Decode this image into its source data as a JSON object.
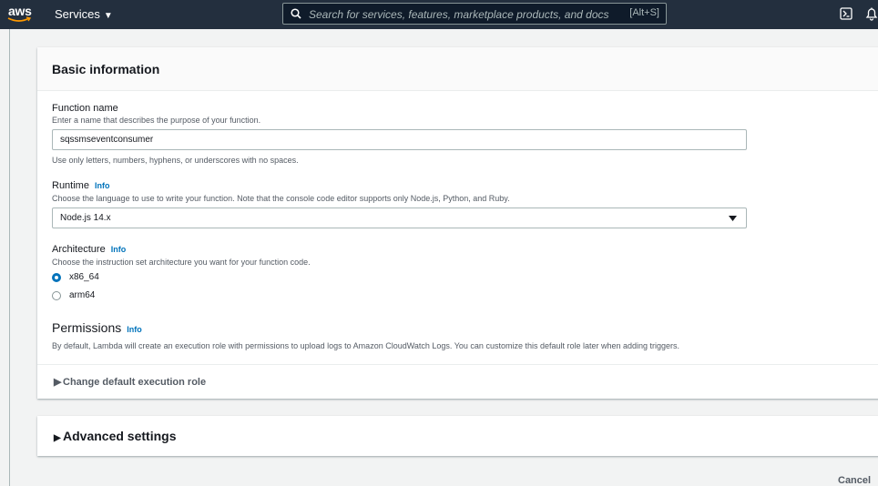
{
  "nav": {
    "logo_text": "aws",
    "services_label": "Services",
    "search_placeholder": "Search for services, features, marketplace products, and docs",
    "search_shortcut": "[Alt+S]"
  },
  "basic_info": {
    "title": "Basic information",
    "function_name": {
      "label": "Function name",
      "description": "Enter a name that describes the purpose of your function.",
      "value": "sqssmseventconsumer",
      "hint": "Use only letters, numbers, hyphens, or underscores with no spaces."
    },
    "runtime": {
      "label": "Runtime",
      "info": "Info",
      "description": "Choose the language to use to write your function. Note that the console code editor supports only Node.js, Python, and Ruby.",
      "selected": "Node.js 14.x"
    },
    "architecture": {
      "label": "Architecture",
      "info": "Info",
      "description": "Choose the instruction set architecture you want for your function code.",
      "options": [
        {
          "label": "x86_64",
          "selected": true
        },
        {
          "label": "arm64",
          "selected": false
        }
      ]
    },
    "permissions": {
      "title": "Permissions",
      "info": "Info",
      "description": "By default, Lambda will create an execution role with permissions to upload logs to Amazon CloudWatch Logs. You can customize this default role later when adding triggers.",
      "expander_label": "Change default execution role"
    }
  },
  "advanced": {
    "label": "Advanced settings"
  },
  "footer": {
    "cancel_label": "Cancel"
  },
  "colors": {
    "nav_bg": "#232f3e",
    "accent": "#0073bb",
    "page_bg": "#f2f3f3"
  }
}
